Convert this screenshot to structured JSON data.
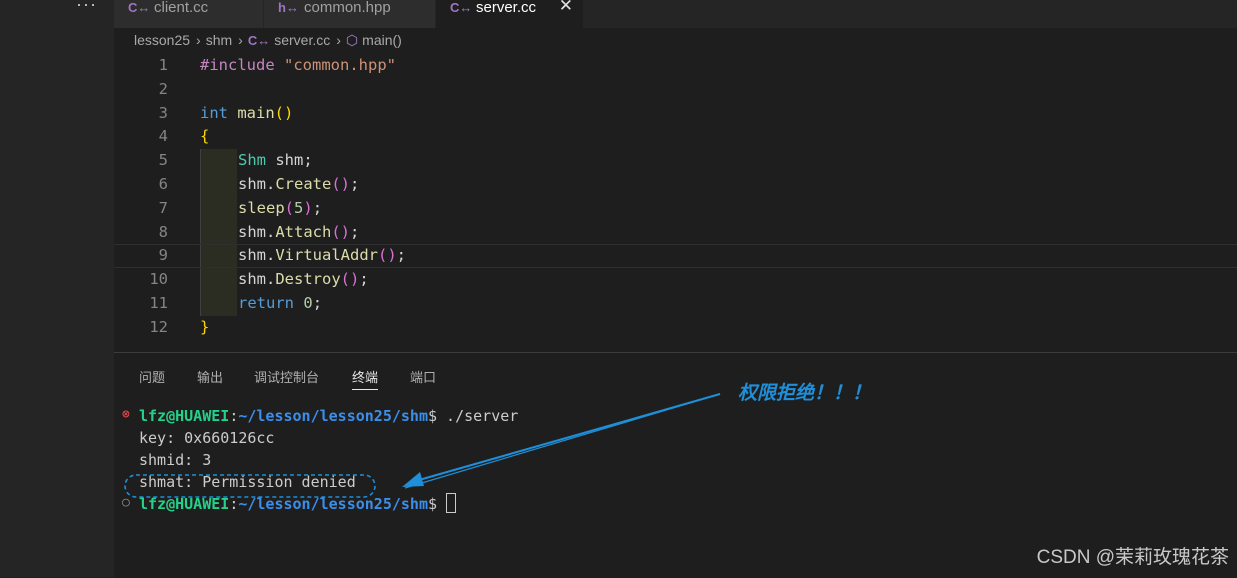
{
  "tabs": [
    {
      "icon": "C↔",
      "label": "client.cc"
    },
    {
      "icon": "h↔",
      "label": "common.hpp"
    },
    {
      "icon": "C↔",
      "label": "server.cc",
      "close": "✕"
    }
  ],
  "breadcrumb": {
    "folder1": "lesson25",
    "folder2": "shm",
    "file_icon": "C↔",
    "file": "server.cc",
    "symbol": "main()"
  },
  "code_lines": [
    {
      "num": "1"
    },
    {
      "num": "2"
    },
    {
      "num": "3"
    },
    {
      "num": "4"
    },
    {
      "num": "5"
    },
    {
      "num": "6"
    },
    {
      "num": "7"
    },
    {
      "num": "8"
    },
    {
      "num": "9"
    },
    {
      "num": "10"
    },
    {
      "num": "11"
    },
    {
      "num": "12"
    }
  ],
  "code": {
    "l1_include": "#include",
    "l1_header": "\"common.hpp\"",
    "l3_type": "int",
    "l3_fn": "main",
    "l3_parens": "()",
    "l4_brace": "{",
    "l5_type": "Shm",
    "l5_rest": " shm;",
    "l6_obj": "shm.",
    "l6_fn": "Create",
    "l7_fn": "sleep",
    "l7_arg": "5",
    "l8_obj": "shm.",
    "l8_fn": "Attach",
    "l9_obj": "shm.",
    "l9_fn": "VirtualAddr",
    "l10_obj": "shm.",
    "l10_fn": "Destroy",
    "l11_kw": "return",
    "l11_val": "0",
    "l12_brace": "}",
    "paren_open": "(",
    "paren_close": ")",
    "empty_call": "()",
    "semi": ";"
  },
  "panel_tabs": [
    "问题",
    "输出",
    "调试控制台",
    "终端",
    "端口"
  ],
  "terminal": {
    "prompt_user": "lfz@HUAWEI",
    "prompt_colon": ":",
    "prompt_path": "~/lesson/lesson25/shm",
    "prompt_dollar": "$",
    "command": " ./server",
    "out1": "key: 0x660126cc",
    "out2": "shmid: 3",
    "out3": "shmat: Permission denied"
  },
  "annotation": "权限拒绝！！！",
  "watermark": "CSDN @茉莉玫瑰花茶",
  "colors": {
    "annotation": "#1e8fd8",
    "error": "#f14c4c"
  }
}
